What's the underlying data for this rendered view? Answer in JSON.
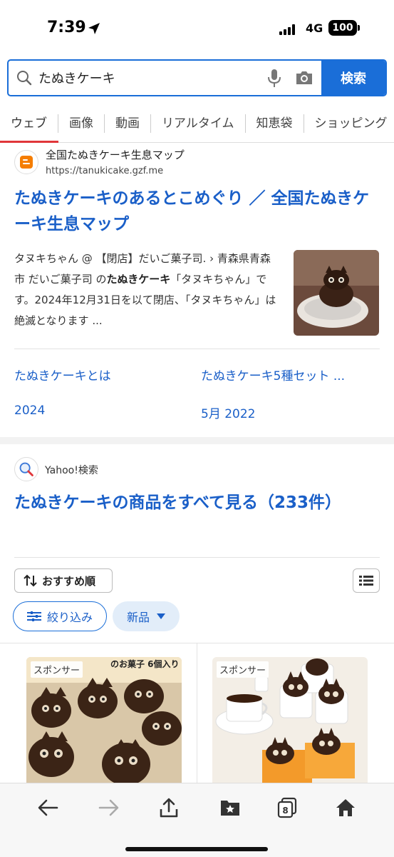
{
  "status": {
    "time": "7:39",
    "network": "4G",
    "battery": "100"
  },
  "search": {
    "query": "たぬきケーキ",
    "placeholder": "",
    "button_label": "検索"
  },
  "tabs": [
    "ウェブ",
    "画像",
    "動画",
    "リアルタイム",
    "知恵袋",
    "ショッピング"
  ],
  "result1": {
    "site_name": "全国たぬきケーキ生息マップ",
    "site_url": "https://tanukicake.gzf.me",
    "title": "たぬきケーキのあるとこめぐり ／ 全国たぬきケーキ生息マップ",
    "snippet_a": "タヌキちゃん @ 【閉店】だいご菓子司. › 青森県青森市 だいご菓子司 の",
    "snippet_bold": "たぬきケーキ",
    "snippet_b": "「タヌキちゃん」です。2024年12月31日を以て閉店、「タヌキちゃん」は絶滅となります ...",
    "sublinks": [
      {
        "label": "たぬきケーキとは"
      },
      {
        "label": "たぬきケーキ5種セット ..."
      },
      {
        "label": "2024"
      },
      {
        "label": "5月 2022"
      }
    ]
  },
  "result2": {
    "site_name": "Yahoo!検索",
    "title": "たぬきケーキの商品をすべて見る（233件）",
    "sort_label": "おすすめ順",
    "filter_label": "絞り込み",
    "new_label": "新品",
    "products": [
      {
        "badge": "スポンサー",
        "overlay_text": "のお菓子 6個入り"
      },
      {
        "badge": "スポンサー"
      }
    ]
  },
  "toolbar": {
    "icons": [
      "back-icon",
      "forward-icon",
      "share-icon",
      "bookmarks-icon",
      "tabs-icon",
      "home-icon"
    ],
    "tab_count": "8"
  },
  "colors": {
    "accent": "#1a6ed8",
    "link": "#1a5fc8",
    "active_tab_underline": "#e0363a"
  }
}
